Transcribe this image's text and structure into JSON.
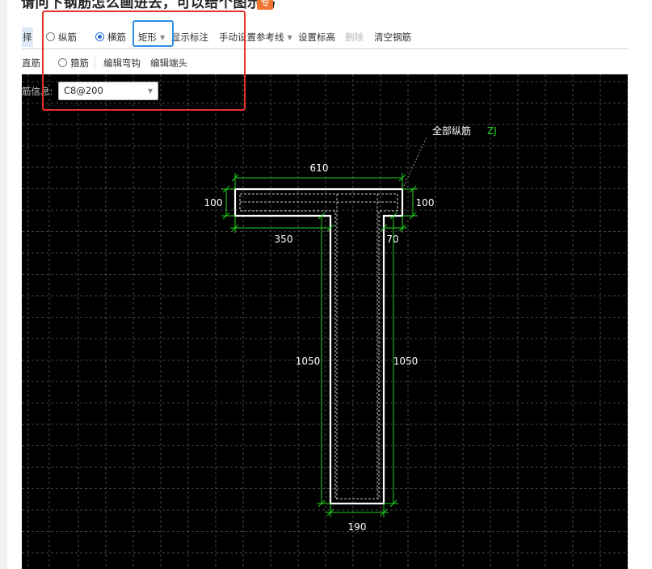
{
  "question": {
    "title": "请问下钢筋怎么画进去，可以给个图示吗",
    "tag": "专"
  },
  "toolbar": {
    "select_tail": "择",
    "radio_longitudinal": "纵筋",
    "radio_transverse": "横筋",
    "shape_dropdown": "矩形",
    "show_annotation": "显示标注",
    "manual_reference": "手动设置参考线",
    "set_elevation": "设置标高",
    "delete": "删除",
    "clear_rebar": "清空钢筋"
  },
  "toolbar2": {
    "straight_rebar": "直筋",
    "radio_stirrup": "箍筋",
    "edit_hook": "编辑弯钩",
    "edit_end": "编辑端头"
  },
  "rebar_info": {
    "label": "筋信息:",
    "value": "C8@200"
  },
  "drawing": {
    "callout_label": "全部纵筋",
    "callout_code": "ZJ",
    "dim_top_width": "610",
    "dim_left_flange": "100",
    "dim_right_flange": "100",
    "dim_left_overhang": "350",
    "dim_right_overhang": "70",
    "dim_left_web": "1050",
    "dim_right_web": "1050",
    "dim_web_width": "190",
    "colors": {
      "background": "#000000",
      "grid": "#5a5a5a",
      "outline": "#ffffff",
      "dimension": "#23d11f",
      "callout_code": "#23d11f"
    }
  }
}
